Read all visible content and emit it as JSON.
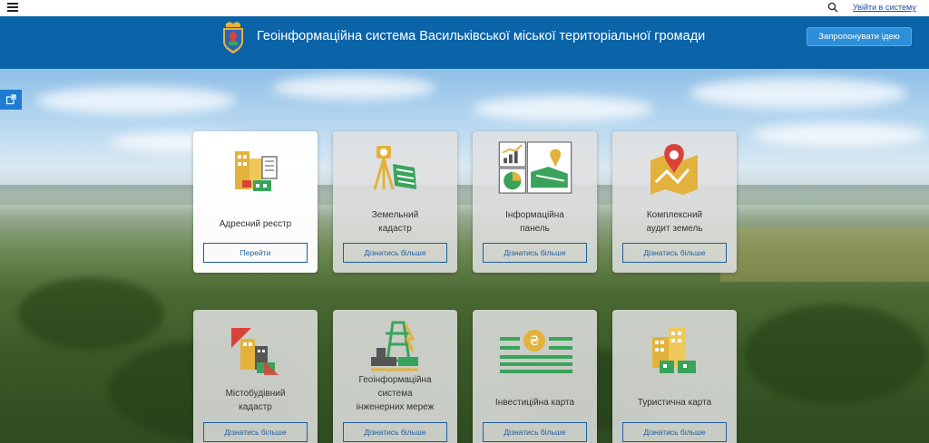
{
  "topbar": {
    "login": "Увійти в систему"
  },
  "header": {
    "title": "Геоінформаційна система Васильківської міської територіальної громади",
    "suggest_button": "Запропонувати ідею"
  },
  "cards": [
    {
      "title": "Адресний реєстр",
      "button": "Перейти",
      "icon": "address-registry-icon"
    },
    {
      "title": "Земельний\nкадастр",
      "button": "Дізнатись більше",
      "icon": "land-cadastre-icon"
    },
    {
      "title": "Інформаційна\nпанель",
      "button": "Дізнатись більше",
      "icon": "dashboard-icon"
    },
    {
      "title": "Комплексний\nаудит земель",
      "button": "Дізнатись більше",
      "icon": "land-audit-icon"
    },
    {
      "title": "Містобудівний\nкадастр",
      "button": "Дізнатись більше",
      "icon": "urban-cadastre-icon"
    },
    {
      "title": "Геоінформаційна\nсистема\nінженерних мереж",
      "button": "Дізнатись більше",
      "icon": "engineering-networks-icon"
    },
    {
      "title": "Інвестиційна карта",
      "button": "Дізнатись більше",
      "icon": "investment-map-icon"
    },
    {
      "title": "Туристична карта",
      "button": "Дізнатись більше",
      "icon": "tourist-map-icon"
    }
  ],
  "colors": {
    "header": "#0b63a8",
    "accent_button": "#2d8fd8",
    "card_button_border": "#1d5e9e",
    "icon_gold": "#e3b23c",
    "icon_green": "#3aa35b",
    "icon_red": "#d9433a"
  }
}
